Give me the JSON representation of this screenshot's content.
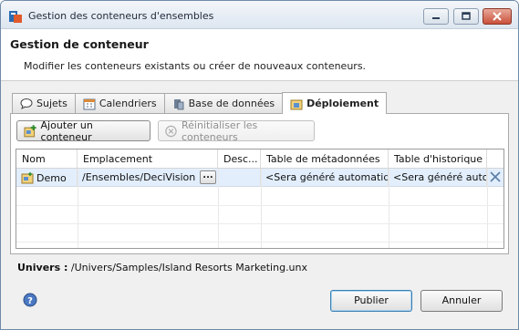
{
  "window": {
    "title": "Gestion des conteneurs d'ensembles"
  },
  "header": {
    "title": "Gestion de conteneur",
    "description": "Modifier les conteneurs existants ou créer de nouveaux conteneurs."
  },
  "tabs": [
    {
      "label": "Sujets",
      "icon": "speech-bubble-icon",
      "active": false
    },
    {
      "label": "Calendriers",
      "icon": "calendar-icon",
      "active": false
    },
    {
      "label": "Base de données",
      "icon": "database-icon",
      "active": false
    },
    {
      "label": "Déploiement",
      "icon": "deployment-icon",
      "active": true
    }
  ],
  "toolbar": {
    "add_label": "Ajouter un conteneur",
    "reset_label": "Réinitialiser les conteneurs"
  },
  "table": {
    "columns": [
      "Nom",
      "Emplacement",
      "Desc...",
      "Table de métadonnées",
      "Table d'historique"
    ],
    "rows": [
      {
        "name": "Demo",
        "location": "/Ensembles/DeciVision",
        "browse_label": "...",
        "description": "",
        "metadata_table": "<Sera généré automatiqu",
        "history_table": "<Sera généré auton"
      }
    ]
  },
  "univers": {
    "label": "Univers :",
    "path": "/Univers/Samples/Island Resorts Marketing.unx"
  },
  "footer": {
    "publish_label": "Publier",
    "cancel_label": "Annuler"
  },
  "colors": {
    "selected_row": "#e2eefc",
    "close_button": "#c9503a",
    "delete_x": "#5b7fa8"
  }
}
